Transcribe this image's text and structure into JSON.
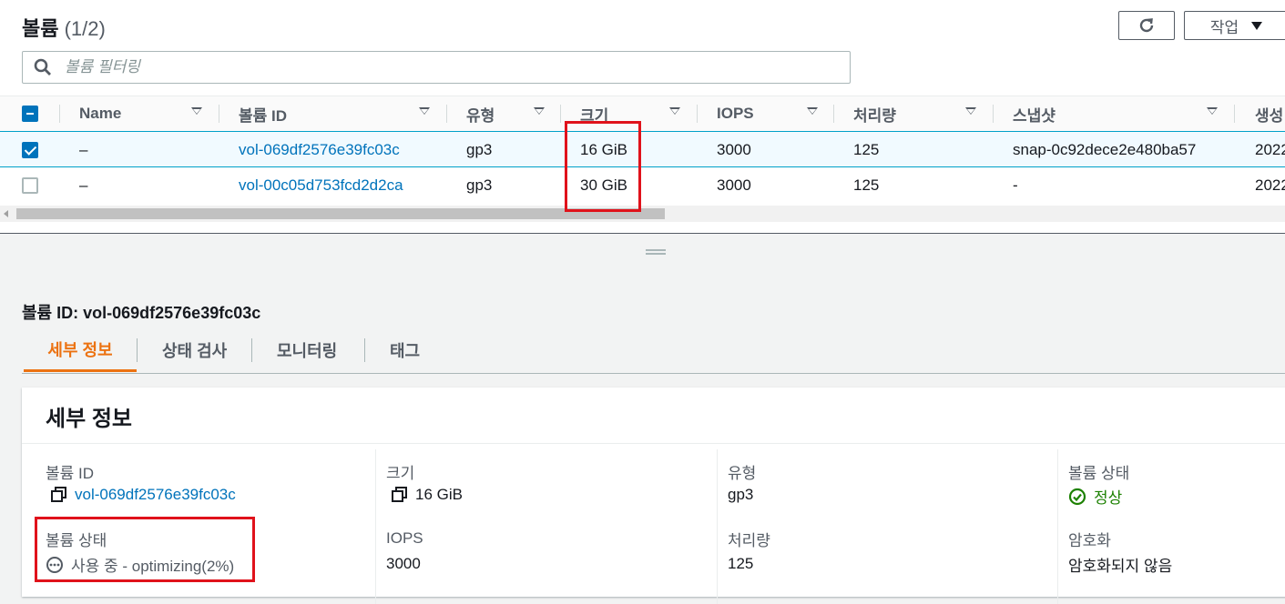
{
  "header": {
    "title": "볼륨",
    "count": "(1/2)",
    "actions_label": "작업"
  },
  "search": {
    "placeholder": "볼륨 필터링"
  },
  "table": {
    "columns": [
      "Name",
      "볼륨 ID",
      "유형",
      "크기",
      "IOPS",
      "처리량",
      "스냅샷",
      "생성"
    ],
    "rows": [
      {
        "selected": true,
        "name": "–",
        "volume_id": "vol-069df2576e39fc03c",
        "type": "gp3",
        "size": "16 GiB",
        "iops": "3000",
        "throughput": "125",
        "snapshot": "snap-0c92dece2e480ba57",
        "created": "2022"
      },
      {
        "selected": false,
        "name": "–",
        "volume_id": "vol-00c05d753fcd2d2ca",
        "type": "gp3",
        "size": "30 GiB",
        "iops": "3000",
        "throughput": "125",
        "snapshot": "-",
        "created": "2022"
      }
    ]
  },
  "detail": {
    "heading": "볼륨 ID: vol-069df2576e39fc03c",
    "tabs": [
      "세부 정보",
      "상태 검사",
      "모니터링",
      "태그"
    ],
    "panel_title": "세부 정보",
    "fields": {
      "volume_id_label": "볼륨 ID",
      "volume_id_value": "vol-069df2576e39fc03c",
      "size_label": "크기",
      "size_value": "16 GiB",
      "type_label": "유형",
      "type_value": "gp3",
      "volume_status_label": "볼륨 상태",
      "volume_status_value": "정상",
      "volume_state_label": "볼륨 상태",
      "volume_state_value": "사용 중 - optimizing(2%)",
      "iops_label": "IOPS",
      "iops_value": "3000",
      "throughput_label": "처리량",
      "throughput_value": "125",
      "encryption_label": "암호화",
      "encryption_value": "암호화되지 않음"
    }
  },
  "colors": {
    "accent": "#ec7211",
    "link": "#0073bb",
    "highlight": "#e0121b",
    "ok": "#1d8102"
  },
  "icons": [
    "search-icon",
    "refresh-icon",
    "caret-down-icon",
    "sort-icon",
    "copy-icon",
    "check-circle-icon",
    "pending-icon"
  ]
}
